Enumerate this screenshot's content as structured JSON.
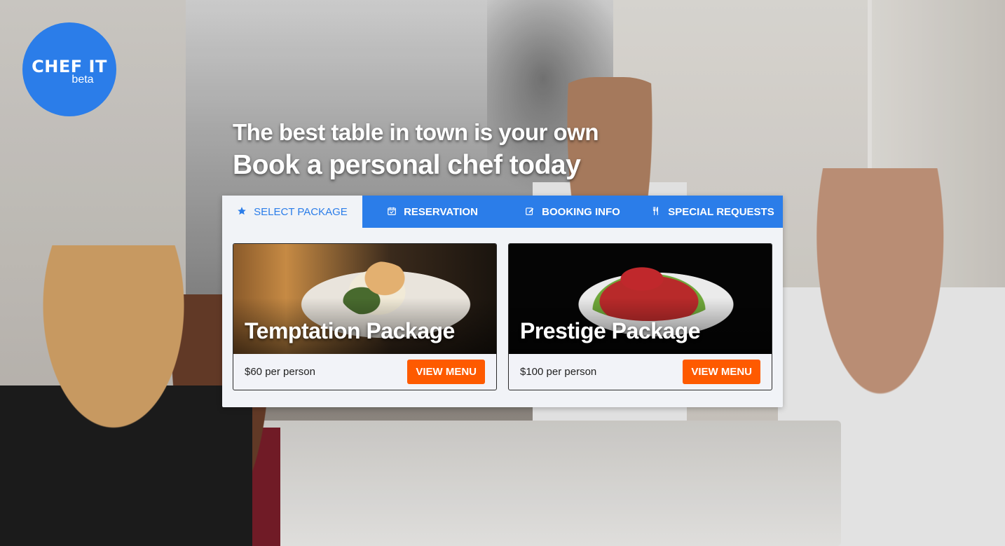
{
  "logo": {
    "brand": "CHEF IT",
    "sub": "beta"
  },
  "hero": {
    "line1": "The best table in town is your own",
    "line2": "Book a personal chef today"
  },
  "tabs": [
    {
      "label": "SELECT PACKAGE",
      "icon": "star-icon",
      "active": true
    },
    {
      "label": "RESERVATION",
      "icon": "calendar-check-icon",
      "active": false
    },
    {
      "label": "BOOKING INFO",
      "icon": "edit-icon",
      "active": false
    },
    {
      "label": "SPECIAL REQUESTS",
      "icon": "utensils-icon",
      "active": false
    }
  ],
  "packages": [
    {
      "title": "Temptation Package",
      "price": "$60 per person",
      "button": "VIEW MENU"
    },
    {
      "title": "Prestige Package",
      "price": "$100 per person",
      "button": "VIEW MENU"
    }
  ],
  "colors": {
    "brand_blue": "#2b7de9",
    "cta_orange": "#fe5a00",
    "panel_bg": "#f1f3f7"
  }
}
